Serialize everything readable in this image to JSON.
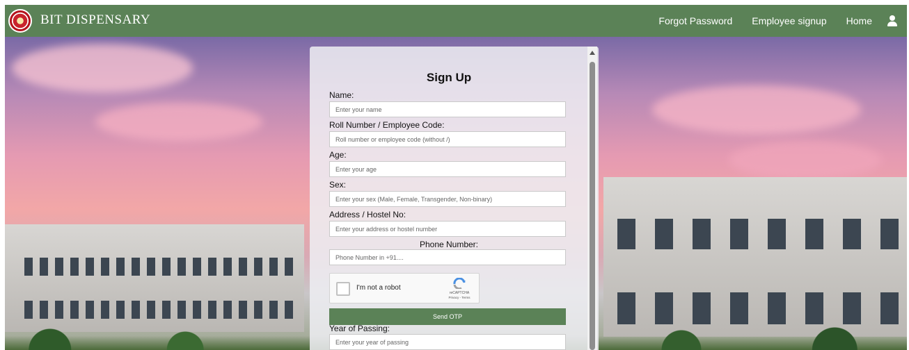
{
  "header": {
    "brand": "BIT DISPENSARY",
    "nav": [
      {
        "label": "Forgot Password"
      },
      {
        "label": "Employee signup"
      },
      {
        "label": "Home"
      }
    ]
  },
  "form": {
    "title": "Sign Up",
    "fields": {
      "name": {
        "label": "Name:",
        "placeholder": "Enter your name"
      },
      "roll": {
        "label": "Roll Number / Employee Code:",
        "placeholder": "Roll number or employee code (without /)"
      },
      "age": {
        "label": "Age:",
        "placeholder": "Enter your age"
      },
      "sex": {
        "label": "Sex:",
        "placeholder": "Enter your sex (Male, Female, Transgender, Non-binary)"
      },
      "address": {
        "label": "Address / Hostel No:",
        "placeholder": "Enter your address or hostel number"
      },
      "phone": {
        "label": "Phone Number:",
        "placeholder": "Phone Number in +91...."
      },
      "year": {
        "label": "Year of Passing:",
        "placeholder": "Enter your year of passing"
      }
    },
    "recaptcha": {
      "label": "I'm not a robot",
      "brand": "reCAPTCHA",
      "terms": "Privacy - Terms"
    },
    "send_otp_label": "Send OTP"
  },
  "colors": {
    "navbar": "#5b8257",
    "button": "#5b8257",
    "recaptcha_blue": "#4a90e2"
  }
}
